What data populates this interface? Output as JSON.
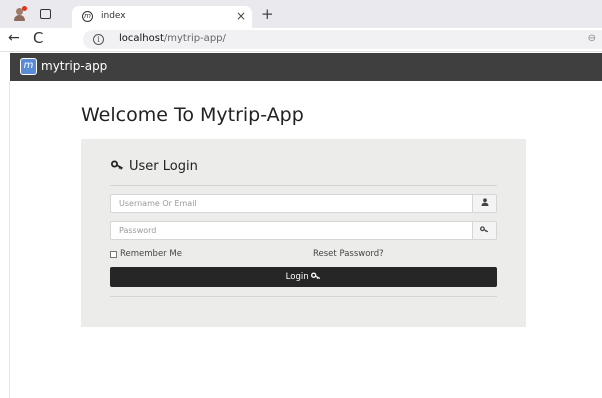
{
  "browser": {
    "tab_title": "index",
    "tab_close": "×",
    "new_tab": "+",
    "back": "←",
    "refresh": "C",
    "url_host": "localhost",
    "url_path": "/mytrip-app/",
    "info_glyph": "i",
    "zoom_glyph": "⊖"
  },
  "app": {
    "brand": "mytrip-app",
    "brand_logo_glyph": "m"
  },
  "page": {
    "heading": "Welcome To Mytrip-App"
  },
  "login": {
    "title": "User Login",
    "title_icon": "key-icon",
    "username_placeholder": "Username Or Email",
    "username_value": "",
    "password_placeholder": "Password",
    "password_value": "",
    "user_addon_icon": "user-icon",
    "password_addon_icon": "key-icon",
    "remember_label": "Remember Me",
    "remember_checked": false,
    "reset_label": "Reset Password?",
    "login_button_label": "Login"
  },
  "colors": {
    "navbar": "#3f3f3f",
    "panel": "#ececea",
    "button": "#262626"
  }
}
